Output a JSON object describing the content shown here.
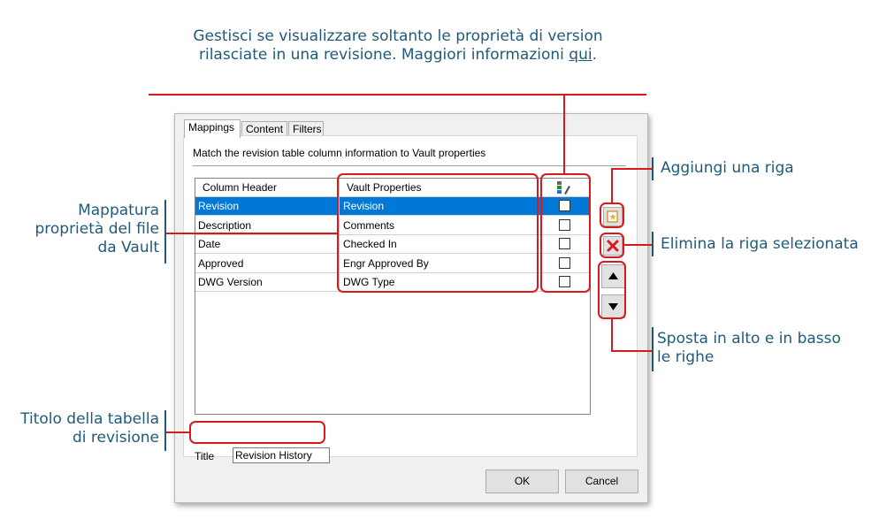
{
  "callouts": {
    "top_line1": "Gestisci se visualizzare soltanto le proprietà di version",
    "top_line2_prefix": "rilasciate in una revisione. Maggiori informazioni ",
    "top_link": "qui",
    "top_suffix": ".",
    "mapping": [
      "Mappatura",
      "proprietà del file",
      "da Vault"
    ],
    "title": [
      "Titolo della tabella",
      "di revisione"
    ],
    "add_row": "Aggiungi una riga",
    "delete_row": "Elimina la riga selezionata",
    "move_rows": [
      "Sposta in alto e in basso",
      "le righe"
    ]
  },
  "dialog": {
    "tabs": [
      "Mappings",
      "Content",
      "Filters"
    ],
    "instruction": "Match the revision table column information to Vault properties",
    "grid": {
      "headers": [
        "Column Header",
        "Vault Properties"
      ],
      "header_icon": "column-settings-icon",
      "rows": [
        {
          "column": "Revision",
          "vault": "Revision",
          "checked": false
        },
        {
          "column": "Description",
          "vault": "Comments",
          "checked": false
        },
        {
          "column": "Date",
          "vault": "Checked In",
          "checked": false
        },
        {
          "column": "Approved",
          "vault": "Engr Approved By",
          "checked": false
        },
        {
          "column": "DWG Version",
          "vault": "DWG Type",
          "checked": false
        }
      ],
      "selected_row": 0
    },
    "title_label": "Title",
    "title_value": "Revision History",
    "ok_label": "OK",
    "cancel_label": "Cancel"
  },
  "colors": {
    "accent_red": "#d71920",
    "callout_text": "#1f5a7a",
    "selection": "#0078d7"
  }
}
